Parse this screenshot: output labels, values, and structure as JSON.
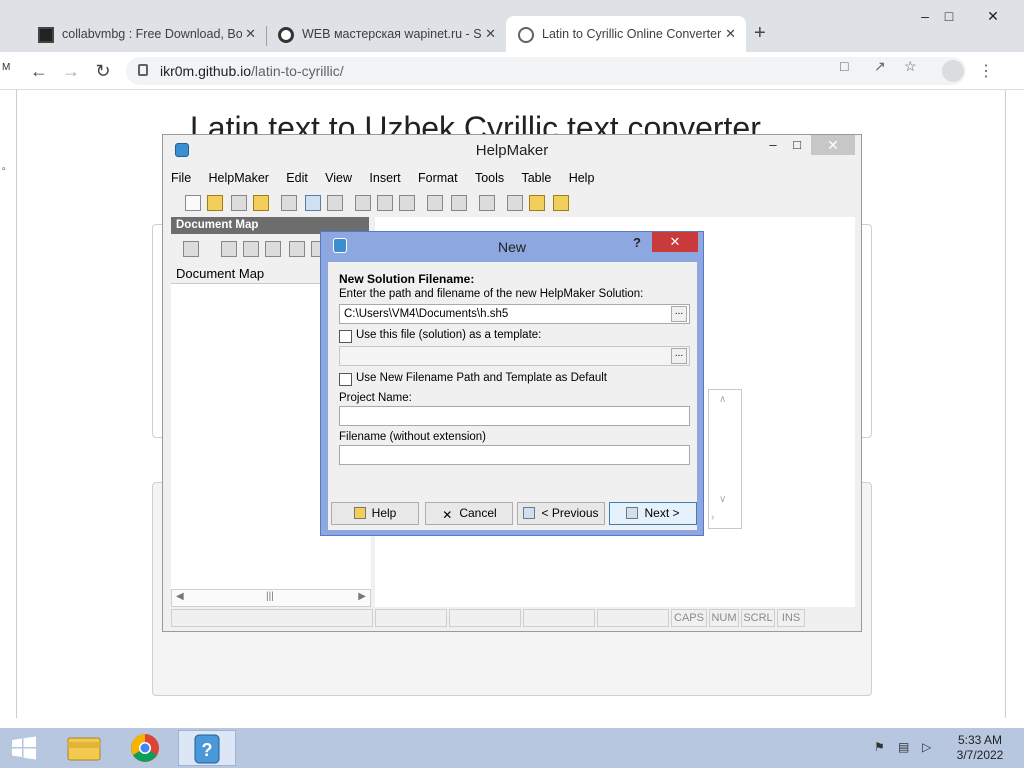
{
  "browser": {
    "tabs": [
      {
        "title": "collabvmbg : Free Download, Bo",
        "active": false
      },
      {
        "title": "WEB мастерская wapinet.ru - Sc",
        "active": false
      },
      {
        "title": "Latin to Cyrillic Online Converter",
        "active": true
      }
    ],
    "url_domain": "ikr0m.github.io",
    "url_path": "/latin-to-cyrillic/"
  },
  "page": {
    "heading": "Latin text to Uzbek Cyrillic text converter"
  },
  "helpmaker": {
    "title": "HelpMaker",
    "menu": [
      "File",
      "HelpMaker",
      "Edit",
      "View",
      "Insert",
      "Format",
      "Tools",
      "Table",
      "Help"
    ],
    "doc_map_header": "Document Map",
    "doc_map_label": "Document Map",
    "status": [
      "CAPS",
      "NUM",
      "SCRL",
      "INS"
    ]
  },
  "dialog": {
    "title": "New",
    "help_mark": "?",
    "heading": "New Solution Filename:",
    "path_prompt": "Enter the path and filename of the new HelpMaker Solution:",
    "path_value": "C:\\Users\\VM4\\Documents\\h.sh5",
    "browse": "...",
    "template_check": "Use this file (solution) as a template:",
    "default_check": "Use New Filename Path and Template as Default",
    "project_label": "Project Name:",
    "filename_label": "Filename (without extension)",
    "buttons": {
      "help": "Help",
      "cancel": "Cancel",
      "previous": "< Previous",
      "next": "Next >"
    }
  },
  "taskbar": {
    "time": "5:33 AM",
    "date": "3/7/2022"
  },
  "colors": {
    "dialog_frame": "#8da8e0",
    "close_red": "#c93a3a",
    "taskbar": "#b8c7e0"
  }
}
